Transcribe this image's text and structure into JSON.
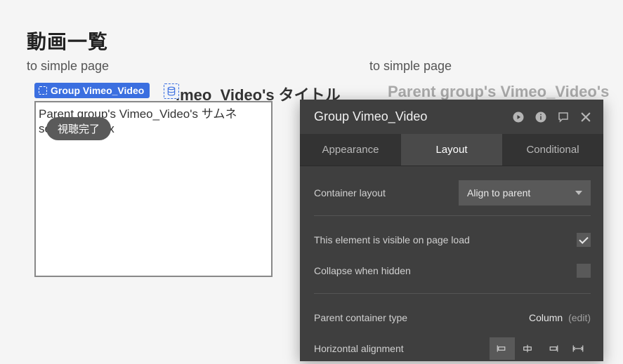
{
  "canvas": {
    "page_title": "動画一覧",
    "link_left": "to simple page",
    "link_right": "to simple page",
    "video_title_left": "imeo_Video's タイトル",
    "video_title_right": "Parent group's Vimeo_Video's ",
    "group_inner_text": "Parent group's Vimeo_Video's サムネ\n                           sed with Imgix",
    "badge_text": "視聴完了",
    "selection_label": "Group Vimeo_Video"
  },
  "panel": {
    "title": "Group Vimeo_Video",
    "tabs": {
      "appearance": "Appearance",
      "layout": "Layout",
      "conditional": "Conditional"
    },
    "rows": {
      "container_layout_label": "Container layout",
      "container_layout_value": "Align to parent",
      "visible_label": "This element is visible on page load",
      "visible_checked": true,
      "collapse_label": "Collapse when hidden",
      "collapse_checked": false,
      "parent_type_label": "Parent container type",
      "parent_type_value": "Column",
      "parent_type_edit": "(edit)",
      "halign_label": "Horizontal alignment"
    }
  }
}
